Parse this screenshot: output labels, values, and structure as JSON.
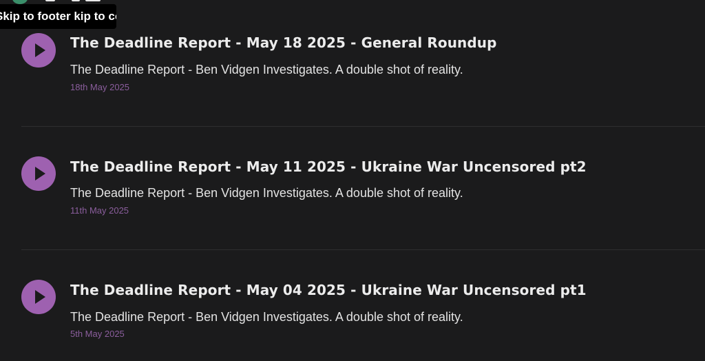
{
  "skip_links": {
    "footer_label": "Skip to footer",
    "content_label": "Skip to content"
  },
  "episodes": [
    {
      "title": "The Deadline Report - May 18 2025 - General Roundup",
      "description": "The Deadline Report - Ben Vidgen Investigates. A double shot of reality.",
      "date": "18th May 2025"
    },
    {
      "title": "The Deadline Report - May 11 2025 - Ukraine War Uncensored pt2",
      "description": "The Deadline Report - Ben Vidgen Investigates. A double shot of reality.",
      "date": "11th May 2025"
    },
    {
      "title": "The Deadline Report - May 04 2025 - Ukraine War Uncensored pt1",
      "description": "The Deadline Report - Ben Vidgen Investigates. A double shot of reality.",
      "date": "5th May 2025"
    }
  ],
  "colors": {
    "background": "#1b1b1c",
    "play_button": "#9e61b0",
    "date_text": "#8b5e9d",
    "title_text": "#ececec"
  },
  "icons": {
    "play": "play-icon"
  }
}
